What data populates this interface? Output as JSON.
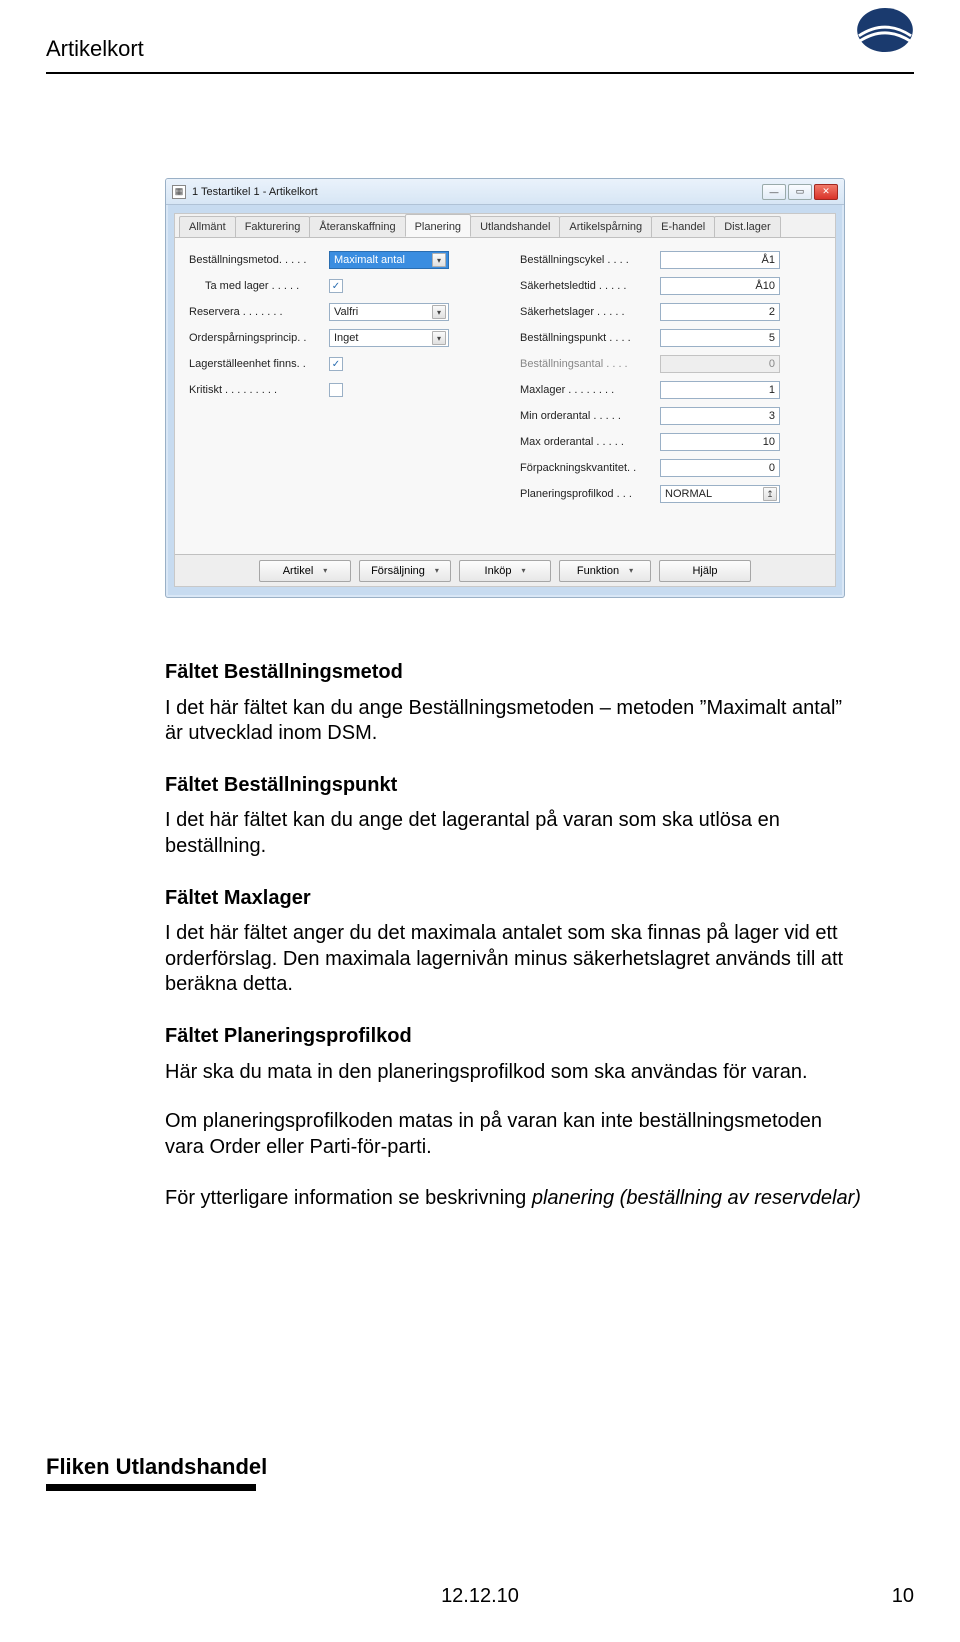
{
  "header": {
    "title": "Artikelkort"
  },
  "screenshot": {
    "window_title": "1 Testartikel 1 - Artikelkort",
    "tabs": [
      {
        "label": "Allmänt"
      },
      {
        "label": "Fakturering"
      },
      {
        "label": "Återanskaffning"
      },
      {
        "label": "Planering",
        "active": true
      },
      {
        "label": "Utlandshandel"
      },
      {
        "label": "Artikelspårning"
      },
      {
        "label": "E-handel"
      },
      {
        "label": "Dist.lager"
      }
    ],
    "left_fields": {
      "bestallningsmetod": {
        "label": "Beställningsmetod. .  .  .  .",
        "value": "Maximalt antal"
      },
      "ta_med_lager": {
        "label": "Ta med lager .  .  .  .  .",
        "checked": true
      },
      "reservera": {
        "label": "Reservera .  .  .  .  .  .  .",
        "value": "Valfri"
      },
      "ordersparning": {
        "label": "Orderspårningsprincip.  .",
        "value": "Inget"
      },
      "lagerstalle": {
        "label": "Lagerställeenhet finns.  .",
        "checked": true
      },
      "kritiskt": {
        "label": "Kritiskt .  .  .  .  .  .  .  .  .",
        "checked": false
      }
    },
    "right_fields": {
      "bestallningscykel": {
        "label": "Beställningscykel .  .  .  .",
        "value": "Å1"
      },
      "sakerhetsledtid": {
        "label": "Säkerhetsledtid .  .  .  .  .",
        "value": "Å10"
      },
      "sakerhetslager": {
        "label": "Säkerhetslager .  .  .  .  .",
        "value": "2"
      },
      "bestallningspunkt": {
        "label": "Beställningspunkt .  .  .  .",
        "value": "5"
      },
      "bestallningsantal": {
        "label": "Beställningsantal .  .  .  .",
        "value": "0",
        "disabled": true
      },
      "maxlager": {
        "label": "Maxlager .  .  .  .  .  .  .  .",
        "value": "1"
      },
      "min_orderantal": {
        "label": "Min orderantal .  .  .  .  .",
        "value": "3"
      },
      "max_orderantal": {
        "label": "Max orderantal .  .  .  .  .",
        "value": "10"
      },
      "forpackning": {
        "label": "Förpackningskvantitet.  .",
        "value": "0"
      },
      "planeringsprofilkod": {
        "label": "Planeringsprofilkod .  .  .",
        "value": "NORMAL"
      }
    },
    "toolbar": {
      "artikel": "Artikel",
      "forsaljning": "Försäljning",
      "inkop": "Inköp",
      "funktion": "Funktion",
      "hjalp": "Hjälp"
    }
  },
  "doc": {
    "s1_h": "Fältet Beställningsmetod",
    "s1_p": "I det här fältet kan du ange Beställningsmetoden – metoden ”Maximalt antal” är utvecklad inom DSM.",
    "s2_h": "Fältet Beställningspunkt",
    "s2_p": "I det här fältet kan du ange det lagerantal på varan som ska utlösa en beställning.",
    "s3_h": "Fältet Maxlager",
    "s3_p": "I det här fältet anger du det maximala antalet som ska finnas på lager vid ett orderförslag. Den maximala lagernivån minus säkerhetslagret används till att beräkna detta.",
    "s4_h": "Fältet Planeringsprofilkod",
    "s4_p1": "Här ska du mata in den planeringsprofilkod som ska användas för varan.",
    "s4_p2": "Om planeringsprofilkoden matas in på varan kan inte beställningsmetoden vara Order eller Parti-för-parti.",
    "s5_p_a": "För ytterligare information se beskrivning ",
    "s5_p_em": "planering (beställning av reservdelar)",
    "section_heading": "Fliken Utlandshandel"
  },
  "footer": {
    "date": "12.12.10",
    "page": "10"
  }
}
